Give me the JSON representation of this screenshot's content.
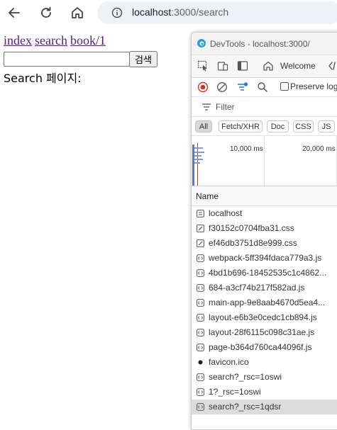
{
  "browser": {
    "url_host": "localhost",
    "url_path": ":3000/search"
  },
  "page": {
    "nav_links": [
      "index",
      "search",
      "book/1"
    ],
    "search_input_value": "",
    "search_button_label": "검색",
    "page_label": "Search 페이지:"
  },
  "devtools": {
    "title": "DevTools - localhost:3000/",
    "welcome_tab": "Welcome",
    "preserve_log_label": "Preserve log",
    "filter_placeholder": "Filter",
    "type_filters": [
      "All",
      "Fetch/XHR",
      "Doc",
      "CSS",
      "JS"
    ],
    "active_type_filter": "All",
    "timeline_labels": [
      "10,000 ms",
      "20,000 ms"
    ],
    "column_header": "Name",
    "requests": [
      {
        "name": "localhost",
        "icon": "document-icon"
      },
      {
        "name": "f30152c0704fba31.css",
        "icon": "stylesheet-icon"
      },
      {
        "name": "ef46db3751d8e999.css",
        "icon": "stylesheet-icon"
      },
      {
        "name": "webpack-5ff394fdaca779a3.js",
        "icon": "script-icon"
      },
      {
        "name": "4bd1b696-18452535c1c4862...",
        "icon": "script-icon"
      },
      {
        "name": "684-a3cf74b217f582ad.js",
        "icon": "script-icon"
      },
      {
        "name": "main-app-9e8aab4670d5ea4...",
        "icon": "script-icon"
      },
      {
        "name": "layout-e6b3e0cedc1cb894.js",
        "icon": "script-icon"
      },
      {
        "name": "layout-28f6115c098c31ae.js",
        "icon": "script-icon"
      },
      {
        "name": "page-b364d760ca44096f.js",
        "icon": "script-icon"
      },
      {
        "name": "favicon.ico",
        "icon": "favicon-icon"
      },
      {
        "name": "search?_rsc=1oswi",
        "icon": "fetch-icon"
      },
      {
        "name": "1?_rsc=1oswi",
        "icon": "fetch-icon"
      },
      {
        "name": "search?_rsc=1qdsr",
        "icon": "fetch-icon"
      }
    ],
    "selected_request_index": 13
  }
}
